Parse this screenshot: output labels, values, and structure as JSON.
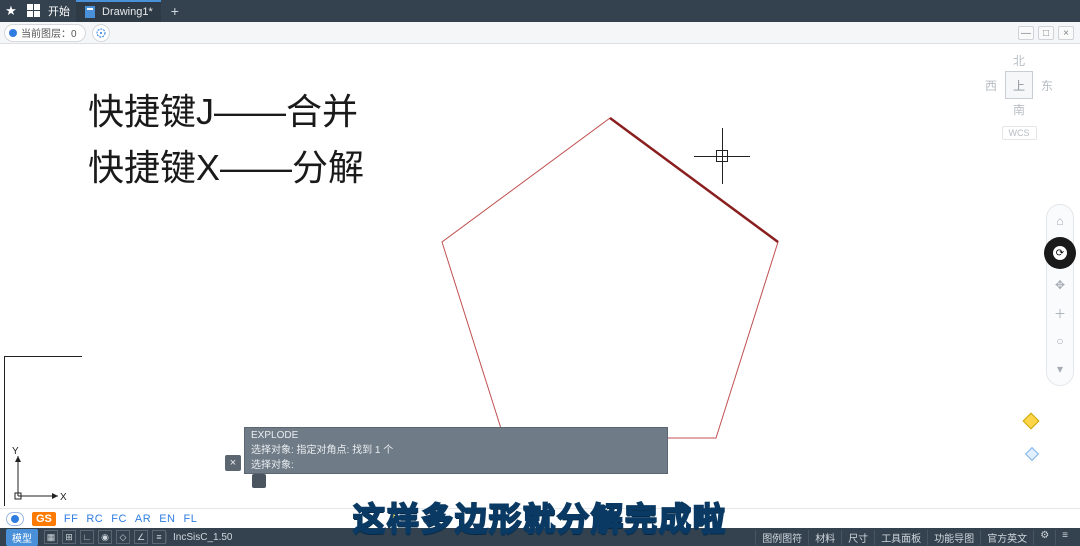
{
  "titlebar": {
    "start": "开始",
    "tab_label": "Drawing1*",
    "plus": "+"
  },
  "layerbar": {
    "label": "当前图层：0"
  },
  "viewcube": {
    "north": "北",
    "south": "南",
    "east": "东",
    "west": "西",
    "top": "上",
    "wcs": "WCS"
  },
  "annotations": {
    "line1": "快捷键J——合并",
    "line2": "快捷键X——分解"
  },
  "ucs": {
    "x": "X",
    "y": "Y"
  },
  "command": {
    "line1": "EXPLODE",
    "line2": "选择对象: 指定对角点: 找到 1 个",
    "line3": "选择对象:"
  },
  "modes": {
    "gs": "GS",
    "m1": "FF",
    "m2": "RC",
    "m3": "FC",
    "m4": "AR",
    "m5": "EN",
    "m6": "FL"
  },
  "status": {
    "model": "模型",
    "right_items": [
      "图例图符",
      "材料",
      "尺寸",
      "工具面板",
      "功能导图",
      "官方英文"
    ],
    "file": "IncSisC_1.50"
  },
  "subtitle": "这样多边形就分解完成啦",
  "icons": {
    "star": "star-icon",
    "windows": "windows-icon",
    "plus": "plus-icon",
    "target": "target-icon",
    "sync": "sync-icon",
    "pan": "pan-icon",
    "zoom": "zoom-icon",
    "orbit": "orbit-icon",
    "close": "close-icon"
  }
}
